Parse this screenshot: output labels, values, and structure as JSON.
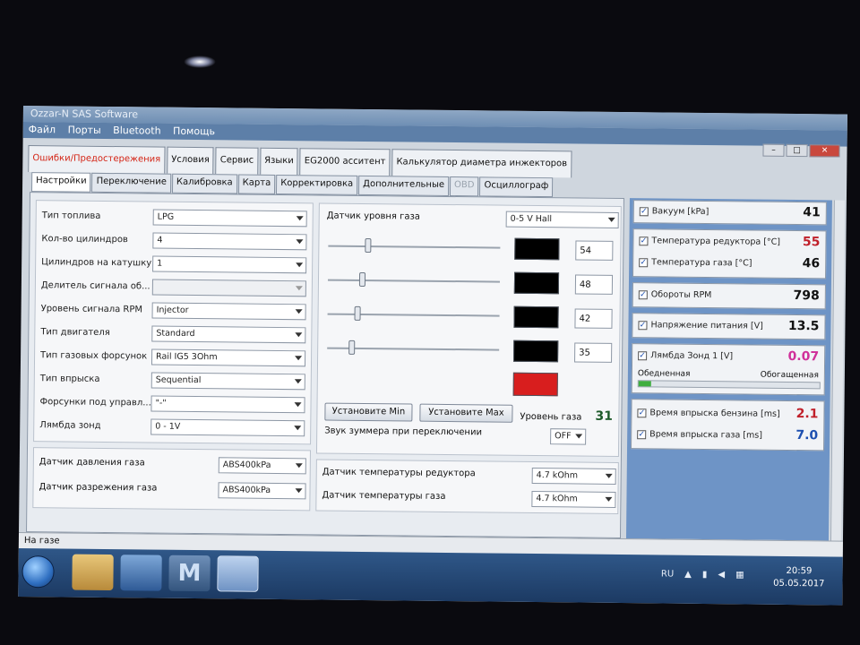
{
  "window": {
    "title": "Ozzar-N SAS Software",
    "menu": [
      "Файл",
      "Порты",
      "Bluetooth",
      "Помощь"
    ]
  },
  "top_tabs": [
    "Ошибки/Предостережения",
    "Условия",
    "Сервис",
    "Языки",
    "EG2000 асситент",
    "Калькулятор диаметра инжекторов"
  ],
  "sub_tabs": [
    "Настройки",
    "Переключение",
    "Калибровка",
    "Карта",
    "Корректировка",
    "Дополнительные",
    "OBD",
    "Осциллограф"
  ],
  "settings": {
    "fields": [
      {
        "label": "Тип топлива",
        "value": "LPG"
      },
      {
        "label": "Кол-во цилиндров",
        "value": "4"
      },
      {
        "label": "Цилиндров на катушку",
        "value": "1"
      },
      {
        "label": "Делитель сигнала об...",
        "value": ""
      },
      {
        "label": "Уровень сигнала RPM",
        "value": "Injector"
      },
      {
        "label": "Тип двигателя",
        "value": "Standard"
      },
      {
        "label": "Тип газовых форсунок",
        "value": "Rail IG5 3Ohm"
      },
      {
        "label": "Тип впрыска",
        "value": "Sequential"
      },
      {
        "label": "Форсунки под управл...",
        "value": "\"-\""
      },
      {
        "label": "Лямбда зонд",
        "value": "0 - 1V"
      }
    ],
    "pressure": [
      {
        "label": "Датчик давления газа",
        "value": "ABS400kPa"
      },
      {
        "label": "Датчик разрежения газа",
        "value": "ABS400kPa"
      }
    ]
  },
  "gas_level": {
    "label": "Датчик уровня газа",
    "sensor_value": "0-5 V Hall",
    "sliders": [
      {
        "value": "54",
        "level": 0.22
      },
      {
        "value": "48",
        "level": 0.19
      },
      {
        "value": "42",
        "level": 0.16
      },
      {
        "value": "35",
        "level": 0.13
      }
    ],
    "btn_min": "Установите Min",
    "btn_max": "Установите Max",
    "level_label": "Уровень газа",
    "level_value": "31",
    "buzzer_label": "Звук зуммера при переключении",
    "buzzer_value": "OFF",
    "indicator_color": "#d81e1e"
  },
  "temp_sensors": [
    {
      "label": "Датчик температуры редуктора",
      "value": "4.7 kOhm"
    },
    {
      "label": "Датчик температуры газа",
      "value": "4.7 kOhm"
    }
  ],
  "readings": {
    "vacuum": {
      "label": "Вакуум [kPa]",
      "value": "41",
      "color": "#111111"
    },
    "reducer_temp": {
      "label": "Температура редуктора [°C]",
      "value": "55",
      "color": "#c0202a"
    },
    "gas_temp": {
      "label": "Температура газа [°C]",
      "value": "46",
      "color": "#111111"
    },
    "rpm": {
      "label": "Обороты RPM",
      "value": "798",
      "color": "#111111"
    },
    "voltage": {
      "label": "Напряжение питания [V]",
      "value": "13.5",
      "color": "#111111"
    },
    "lambda": {
      "label": "Лямбда Зонд 1 [V]",
      "value": "0.07",
      "color": "#d0309a",
      "lean": "Обедненная",
      "rich": "Обогащенная",
      "level": 0.07
    },
    "petrol_inj": {
      "label": "Время впрыска бензина [ms]",
      "value": "2.1",
      "color": "#c0202a"
    },
    "gas_inj": {
      "label": "Время впрыска газа [ms]",
      "value": "7.0",
      "color": "#1d4fb0"
    }
  },
  "status": "На газе",
  "taskbar": {
    "lang": "RU",
    "time": "20:59",
    "date": "05.05.2017",
    "app_letter": "M"
  }
}
